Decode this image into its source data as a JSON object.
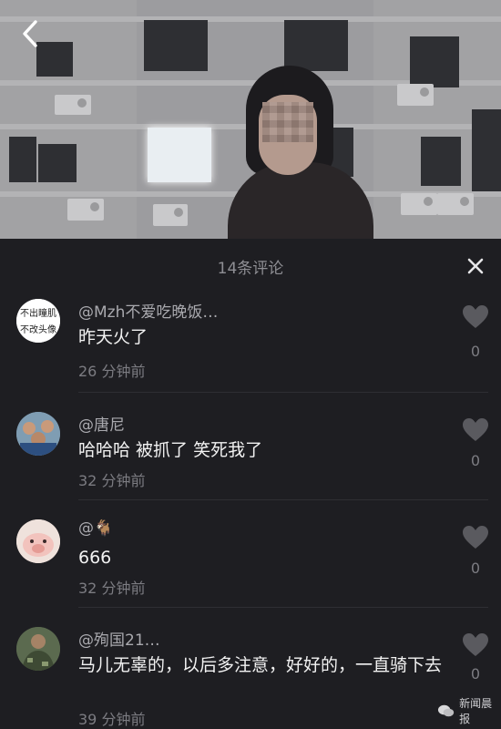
{
  "comments_header": {
    "title": "14条评论"
  },
  "comments": [
    {
      "avatar_text_top": "不出瞳肌",
      "avatar_text_bottom": "不改头像",
      "username": "@Mzh不爱吃晚饭…",
      "text": "昨天火了",
      "time": "26 分钟前",
      "likes": "0"
    },
    {
      "username": "@唐尼",
      "text": "哈哈哈 被抓了 笑死我了",
      "time": "32 分钟前",
      "likes": "0"
    },
    {
      "username": "@🐐",
      "text": "666",
      "time": "32 分钟前",
      "likes": "0"
    },
    {
      "username": "@殉国21…",
      "text": "马儿无辜的，以后多注意，好好的，一直骑下去",
      "time": "39 分钟前",
      "likes": "0"
    }
  ],
  "watermark": {
    "label": "新闻晨报"
  },
  "colors": {
    "panel_bg": "#1e1e22",
    "text_primary": "#f2f2f2",
    "text_secondary": "#7c7c82"
  },
  "icons": {
    "back": "chevron-left-icon",
    "close": "close-icon",
    "like": "heart-icon"
  }
}
